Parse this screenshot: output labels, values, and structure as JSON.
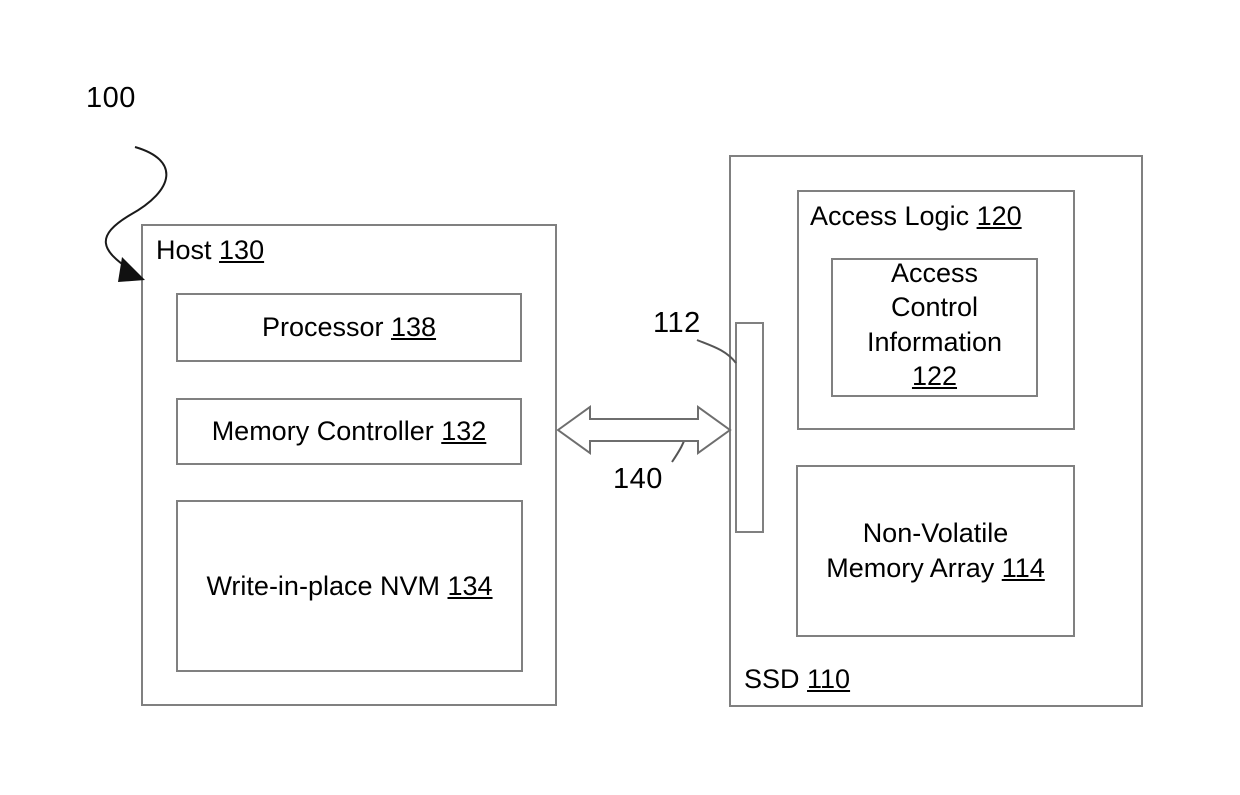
{
  "figure": {
    "title_ref": "100",
    "background": "#ffffff",
    "line_color": "#808080",
    "text_color": "#000000"
  },
  "host": {
    "label_text": "Host ",
    "label_ref": "130",
    "components": [
      {
        "name": "processor",
        "text": "Processor ",
        "ref": "138"
      },
      {
        "name": "memory-controller",
        "text": "Memory Controller ",
        "ref": "132"
      },
      {
        "name": "write-in-place-nvm",
        "text": "Write-in-place NVM ",
        "ref": "134"
      }
    ]
  },
  "ssd": {
    "label_text": "SSD ",
    "label_ref": "110",
    "access_logic": {
      "label_text": "Access Logic ",
      "label_ref": "120",
      "inner": {
        "text": "Access\nControl\nInformation\n",
        "ref": "122"
      }
    },
    "memory_array": {
      "text": "Non-Volatile\nMemory Array ",
      "ref": "114"
    }
  },
  "interface": {
    "ref": "112"
  },
  "link": {
    "ref": "140"
  }
}
